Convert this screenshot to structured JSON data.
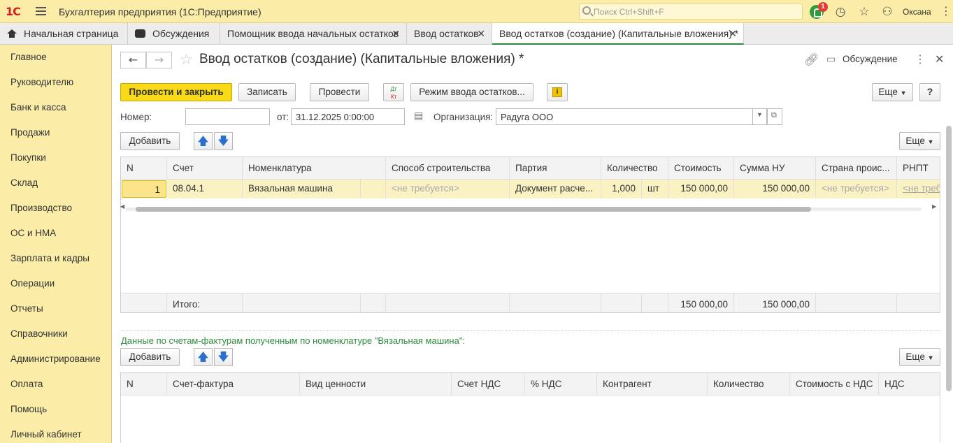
{
  "app": {
    "logo": "1С",
    "title": "Бухгалтерия предприятия (1С:Предприятие)",
    "search_placeholder": "Поиск Ctrl+Shift+F",
    "notifications_count": "1",
    "user": "Оксана",
    "icons": [
      "bell-icon",
      "history-icon",
      "star-icon",
      "user-icon",
      "menu-icon"
    ]
  },
  "tabs": [
    {
      "label": "Начальная страница"
    },
    {
      "label": "Обсуждения"
    },
    {
      "label": "Помощник ввода начальных остатков"
    },
    {
      "label": "Ввод остатков"
    },
    {
      "label": "Ввод остатков (создание) (Капитальные вложения) *"
    }
  ],
  "sidebar": {
    "items": [
      "Главное",
      "Руководителю",
      "Банк и касса",
      "Продажи",
      "Покупки",
      "Склад",
      "Производство",
      "ОС и НМА",
      "Зарплата и кадры",
      "Операции",
      "Отчеты",
      "Справочники",
      "Администрирование",
      "Оплата",
      "Помощь",
      "Личный кабинет"
    ]
  },
  "form": {
    "title": "Ввод остатков (создание) (Капитальные вложения) *",
    "discussion": "Обсуждение",
    "toolbar": {
      "post_close": "Провести и закрыть",
      "save": "Записать",
      "post": "Провести",
      "dtkt": "Дт Кт",
      "mode": "Режим ввода остатков...",
      "more": "Еще",
      "help": "?"
    },
    "number_label": "Номер:",
    "number_value": "",
    "date_label": "от:",
    "date_value": "31.12.2025  0:00:00",
    "org_label": "Организация:",
    "org_value": "Радуга ООО",
    "add": "Добавить",
    "more": "Еще"
  },
  "table1": {
    "headers": [
      "N",
      "Счет",
      "Номенклатура",
      "Способ строительства",
      "Партия",
      "Количество",
      "Стоимость",
      "Сумма НУ",
      "Страна проис...",
      "РНПТ"
    ],
    "row": {
      "n": "1",
      "account": "08.04.1",
      "item": "Вязальная машина",
      "method": "<не требуется>",
      "batch": "Документ расче...",
      "qty": "1,000",
      "unit": "шт",
      "cost": "150 000,00",
      "tax_sum": "150 000,00",
      "country": "<не требуется>",
      "rnpt": "<не треб"
    },
    "footer": {
      "label": "Итого:",
      "cost": "150 000,00",
      "tax_sum": "150 000,00"
    }
  },
  "section2": {
    "caption": "Данные по счетам-фактурам полученным по номенклатуре \"Вязальная машина\":",
    "add": "Добавить",
    "more": "Еще",
    "headers": [
      "N",
      "Счет-фактура",
      "Вид ценности",
      "Счет НДС",
      "% НДС",
      "Контрагент",
      "Количество",
      "Стоимость с НДС",
      "НДС"
    ]
  }
}
